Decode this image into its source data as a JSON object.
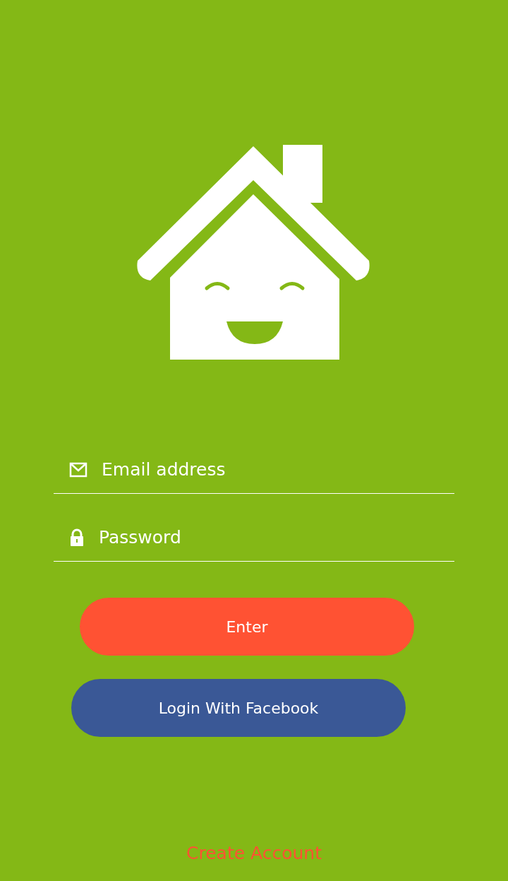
{
  "fields": [
    {
      "kind": "email",
      "placeholder": "Email address"
    },
    {
      "kind": "password",
      "placeholder": "Password"
    }
  ],
  "buttons": [
    {
      "kind": "primary",
      "label": "Enter"
    },
    {
      "kind": "facebook",
      "label": "Login With Facebook"
    }
  ],
  "create_account_link": "Create Account"
}
